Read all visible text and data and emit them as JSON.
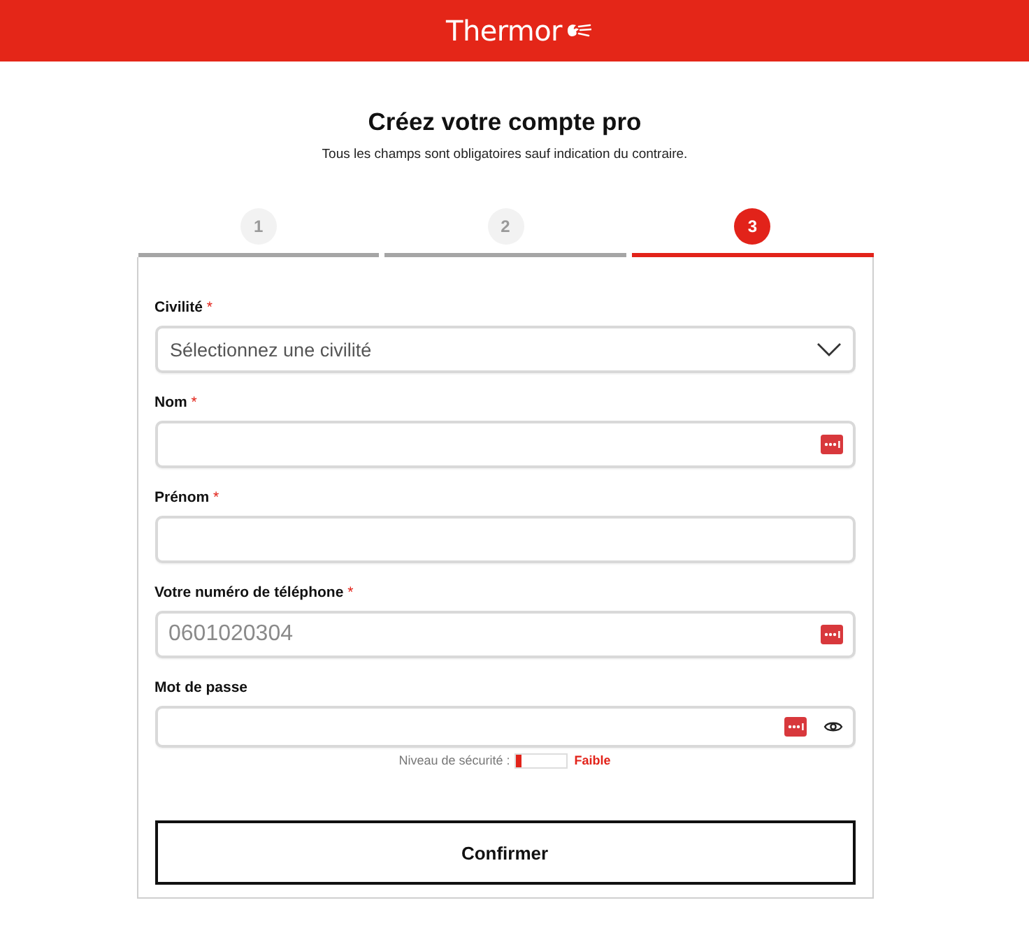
{
  "header": {
    "logo": "Thermor"
  },
  "page": {
    "title": "Créez votre compte pro",
    "subtitle": "Tous les champs sont obligatoires sauf indication du contraire."
  },
  "steps": [
    {
      "label": "1",
      "selected": false
    },
    {
      "label": "2",
      "selected": false
    },
    {
      "label": "3",
      "selected": true
    }
  ],
  "fields": [
    {
      "kind": "select",
      "label": "Civilité",
      "required_mark": "*",
      "placeholder": "Sélectionnez une civilité"
    },
    {
      "kind": "text",
      "label": "Nom",
      "required_mark": "*",
      "autofill": true
    },
    {
      "kind": "text",
      "label": "Prénom",
      "required_mark": "*",
      "autofill": false
    },
    {
      "kind": "text",
      "label": "Votre numéro de téléphone",
      "required_mark": "*",
      "placeholder": "0601020304",
      "autofill": true
    },
    {
      "kind": "password",
      "label": "Mot de passe",
      "autofill": true,
      "strength": {
        "label": "Niveau de sécurité :",
        "level": 0.12,
        "rating": "Faible"
      }
    }
  ],
  "submit": {
    "label": "Confirmer"
  }
}
